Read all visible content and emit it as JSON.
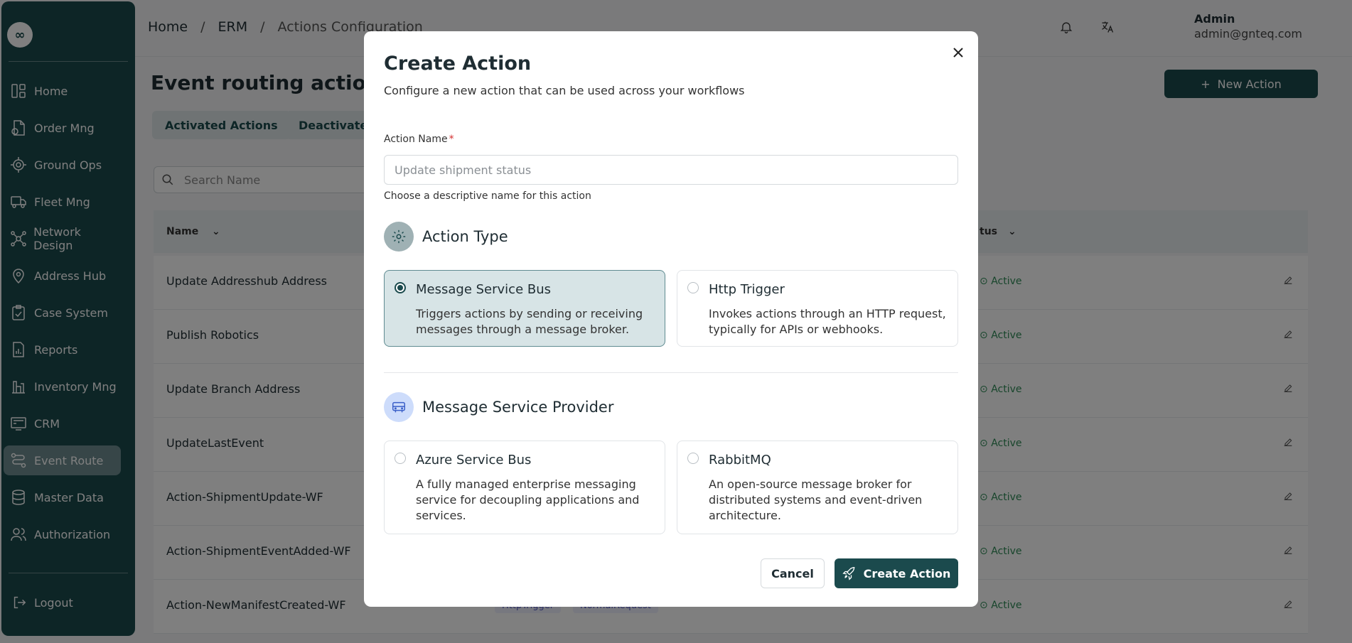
{
  "sidebar": {
    "logo_glyph": "∞",
    "items": [
      {
        "label": "Home",
        "icon": "home-icon"
      },
      {
        "label": "Order Mng",
        "icon": "order-icon"
      },
      {
        "label": "Ground Ops",
        "icon": "ground-ops-icon"
      },
      {
        "label": "Fleet Mng",
        "icon": "truck-icon"
      },
      {
        "label": "Network Design",
        "icon": "network-icon"
      },
      {
        "label": "Address Hub",
        "icon": "location-icon"
      },
      {
        "label": "Case System",
        "icon": "case-icon"
      },
      {
        "label": "Reports",
        "icon": "reports-icon"
      },
      {
        "label": "Inventory Mng",
        "icon": "inventory-icon"
      },
      {
        "label": "CRM",
        "icon": "crm-icon"
      },
      {
        "label": "Event Route",
        "icon": "route-icon",
        "active": true
      },
      {
        "label": "Master Data",
        "icon": "database-icon"
      },
      {
        "label": "Authorization",
        "icon": "users-icon"
      }
    ],
    "logout_label": "Logout"
  },
  "header": {
    "breadcrumb": [
      "Home",
      "ERM",
      "Actions Configuration"
    ],
    "breadcrumb_sep": "/",
    "user_name": "Admin",
    "user_email": "admin@gnteq.com"
  },
  "page": {
    "title": "Event routing actions",
    "new_action_label": "New Action",
    "new_action_glyph": "+",
    "tabs": [
      "Activated Actions",
      "Deactivated"
    ],
    "search_placeholder": "Search Name",
    "columns": {
      "name": "Name",
      "status": "tus"
    },
    "sort_glyph": "⌄",
    "rows": [
      {
        "name": "Update Addresshub Address",
        "status": "Active"
      },
      {
        "name": "Publish Robotics",
        "status": "Active"
      },
      {
        "name": "Update Branch Address",
        "status": "Active"
      },
      {
        "name": "UpdateLastEvent",
        "status": "Active"
      },
      {
        "name": "Action-ShipmentUpdate-WF",
        "status": "Active"
      },
      {
        "name": "Action-ShipmentEventAdded-WF",
        "status": "Active"
      },
      {
        "name": "Action-NewManifestCreated-WF",
        "status": "Active",
        "tags": [
          "HttpTrigger",
          "NormalRequest"
        ]
      }
    ],
    "status_glyph": "⊙"
  },
  "modal": {
    "title": "Create Action",
    "subtitle": "Configure a new action that can be used across your workflows",
    "action_name_label": "Action Name",
    "required_mark": "*",
    "action_name_placeholder": "Update shipment status",
    "action_name_value": "",
    "action_name_help": "Choose a descriptive name for this action",
    "action_type_title": "Action Type",
    "action_types": [
      {
        "title": "Message Service Bus",
        "desc": "Triggers actions by sending or receiving messages through a message broker.",
        "selected": true
      },
      {
        "title": "Http Trigger",
        "desc": "Invokes actions through an HTTP request, typically for APIs or webhooks.",
        "selected": false
      }
    ],
    "provider_title": "Message Service Provider",
    "providers": [
      {
        "title": "Azure Service Bus",
        "desc": "A fully managed enterprise messaging service for decoupling applications and services.",
        "selected": false
      },
      {
        "title": "RabbitMQ",
        "desc": "An open-source message broker for distributed systems and event-driven architecture.",
        "selected": false
      }
    ],
    "cancel_label": "Cancel",
    "create_label": "Create Action"
  },
  "colors": {
    "brand": "#1b4a4d",
    "selected_card_bg": "#d7e4e6",
    "required": "#d32f2f",
    "active_status": "#2e8b57"
  }
}
